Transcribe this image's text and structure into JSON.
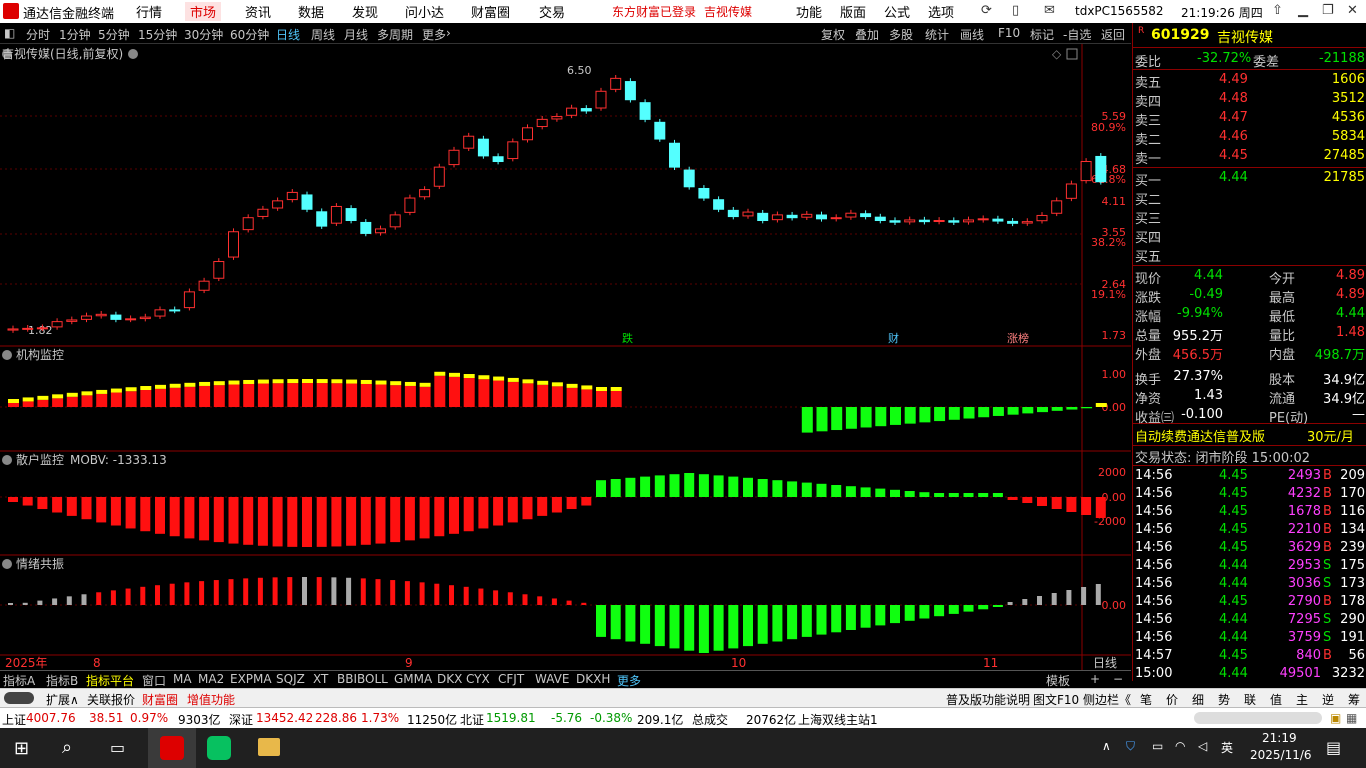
{
  "menubar": {
    "app_title": "通达信金融终端",
    "items": [
      "行情",
      "市场",
      "资讯",
      "数据",
      "发现",
      "问小达",
      "财富圈",
      "交易"
    ],
    "login_text": "东方财富已登录",
    "stock_short": "吉视传媒",
    "right_items": [
      "功能",
      "版面",
      "公式",
      "选项"
    ],
    "user": "tdxPC1565582",
    "clock": "21:19:26 周四"
  },
  "toolbar": {
    "periods": [
      "分时",
      "1分钟",
      "5分钟",
      "15分钟",
      "30分钟",
      "60分钟",
      "日线",
      "周线",
      "月线",
      "多周期",
      "更多"
    ],
    "selected": "日线",
    "actions": [
      "复权",
      "叠加",
      "多股",
      "统计",
      "画线",
      "F10",
      "标记",
      "-自选",
      "返回"
    ]
  },
  "chart": {
    "title": "吉视传媒(日线,前复权)",
    "price_high_label": "6.50",
    "price_low_label": "1.82",
    "price_axis": [
      "5.59",
      "80.9%",
      "4.68",
      "61.8%",
      "4.11",
      "3.55",
      "38.2%",
      "2.64",
      "19.1%",
      "1.73"
    ],
    "annotations": [
      "跌",
      "财",
      "涨榜"
    ],
    "panel2_title": "机构监控",
    "panel2_axis": [
      "1.00",
      "0.00"
    ],
    "panel3_title": "散户监控",
    "panel3_value": "MOBV: -1333.13",
    "panel3_axis": [
      "2000",
      "0.00",
      "-2000"
    ],
    "panel4_title": "情绪共振",
    "panel4_axis": [
      "0.00"
    ],
    "date_labels": [
      "2025年",
      "8",
      "9",
      "10",
      "11"
    ],
    "period_label": "日线"
  },
  "quote": {
    "code": "601929",
    "name": "吉视传媒",
    "weibi_label": "委比",
    "weibi": "-32.72%",
    "weicha_label": "委差",
    "weicha": "-21188",
    "asks": [
      {
        "label": "卖五",
        "price": "4.49",
        "vol": "1606"
      },
      {
        "label": "卖四",
        "price": "4.48",
        "vol": "3512"
      },
      {
        "label": "卖三",
        "price": "4.47",
        "vol": "4536"
      },
      {
        "label": "卖二",
        "price": "4.46",
        "vol": "5834"
      },
      {
        "label": "卖一",
        "price": "4.45",
        "vol": "27485"
      }
    ],
    "bids": [
      {
        "label": "买一",
        "price": "4.44",
        "vol": "21785"
      },
      {
        "label": "买二",
        "price": "",
        "vol": ""
      },
      {
        "label": "买三",
        "price": "",
        "vol": ""
      },
      {
        "label": "买四",
        "price": "",
        "vol": ""
      },
      {
        "label": "买五",
        "price": "",
        "vol": ""
      }
    ],
    "stats": [
      [
        "现价",
        "4.44",
        "今开",
        "4.89"
      ],
      [
        "涨跌",
        "-0.49",
        "最高",
        "4.89"
      ],
      [
        "涨幅",
        "-9.94%",
        "最低",
        "4.44"
      ],
      [
        "总量",
        "955.2万",
        "量比",
        "1.48"
      ],
      [
        "外盘",
        "456.5万",
        "内盘",
        "498.7万"
      ],
      [
        "换手",
        "27.37%",
        "股本",
        "34.9亿"
      ],
      [
        "净资",
        "1.43",
        "流通",
        "34.9亿"
      ],
      [
        "收益㈢",
        "-0.100",
        "PE(动)",
        "—"
      ]
    ],
    "ad_text": "自动续费通达信普及版",
    "ad_price": "30元/月",
    "trade_state": "交易状态: 闭市阶段 15:00:02",
    "ticks": [
      [
        "14:56",
        "4.45",
        "2493",
        "B",
        "209"
      ],
      [
        "14:56",
        "4.45",
        "4232",
        "B",
        "170"
      ],
      [
        "14:56",
        "4.45",
        "1678",
        "B",
        "116"
      ],
      [
        "14:56",
        "4.45",
        "2210",
        "B",
        "134"
      ],
      [
        "14:56",
        "4.45",
        "3629",
        "B",
        "239"
      ],
      [
        "14:56",
        "4.44",
        "2953",
        "S",
        "175"
      ],
      [
        "14:56",
        "4.44",
        "3036",
        "S",
        "173"
      ],
      [
        "14:56",
        "4.45",
        "2790",
        "B",
        "178"
      ],
      [
        "14:56",
        "4.44",
        "7295",
        "S",
        "290"
      ],
      [
        "14:56",
        "4.44",
        "3759",
        "S",
        "191"
      ],
      [
        "14:57",
        "4.45",
        "840",
        "B",
        "56"
      ],
      [
        "15:00",
        "4.44",
        "49501",
        "",
        "3232"
      ]
    ]
  },
  "bottomtabs": {
    "items": [
      "指标A",
      "指标B",
      "指标平台",
      "窗口",
      "MA",
      "MA2",
      "EXPMA",
      "SQJZ",
      "XT",
      "BBIBOLL",
      "GMMA",
      "DKX",
      "CYX",
      "CFJT",
      "WAVE",
      "DKXH",
      "更多"
    ],
    "right": [
      "模板",
      "+",
      "−"
    ]
  },
  "bottom2": {
    "left": [
      "扩展∧",
      "关联报价",
      "财富圈",
      "增值功能"
    ],
    "right": [
      "普及版功能说明",
      "图文F10",
      "侧边栏《"
    ],
    "side_tabs": [
      "笔",
      "价",
      "细",
      "势",
      "联",
      "值",
      "主",
      "逆",
      "筹"
    ]
  },
  "statusbar": {
    "sh_label": "上证",
    "sh_value": "4007.76",
    "sh_change": "38.51",
    "sh_pct": "0.97%",
    "sh_amount": "9303亿",
    "sz_label": "深证",
    "sz_value": "13452.42",
    "sz_change": "228.86",
    "sz_pct": "1.73%",
    "sz_amount": "11250亿",
    "bz_label": "北证",
    "bz_value": "1519.81",
    "bz_change": "-5.76",
    "bz_pct": "-0.38%",
    "bz_amount": "209.1亿",
    "total_label": "总成交",
    "total_amount": "20762亿",
    "server": "上海双线主站1"
  },
  "taskbar": {
    "time": "21:19",
    "date": "2025/11/6",
    "ime": "英"
  }
}
